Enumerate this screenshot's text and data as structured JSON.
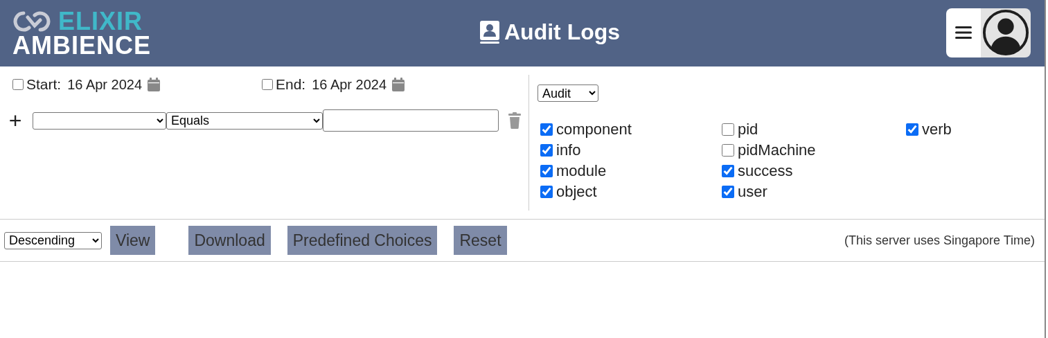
{
  "header": {
    "logo": {
      "top": "ELIXIR",
      "bottom": "AMBIENCE"
    },
    "title": "Audit Logs"
  },
  "dates": [
    {
      "label": "Start:",
      "value": "16 Apr 2024",
      "checked": false
    },
    {
      "label": "End:",
      "value": "16 Apr 2024",
      "checked": false
    }
  ],
  "filter": {
    "add": "+",
    "operator": "Equals"
  },
  "log_type": "Audit",
  "columns": [
    {
      "label": "component",
      "checked": true
    },
    {
      "label": "info",
      "checked": true
    },
    {
      "label": "module",
      "checked": true
    },
    {
      "label": "object",
      "checked": true
    },
    {
      "label": "pid",
      "checked": false
    },
    {
      "label": "pidMachine",
      "checked": false
    },
    {
      "label": "success",
      "checked": true
    },
    {
      "label": "user",
      "checked": true
    },
    {
      "label": "verb",
      "checked": true
    }
  ],
  "sort": "Descending",
  "buttons": [
    "View",
    "Download",
    "Predefined Choices",
    "Reset"
  ],
  "timezone_note": "(This server uses Singapore Time)"
}
